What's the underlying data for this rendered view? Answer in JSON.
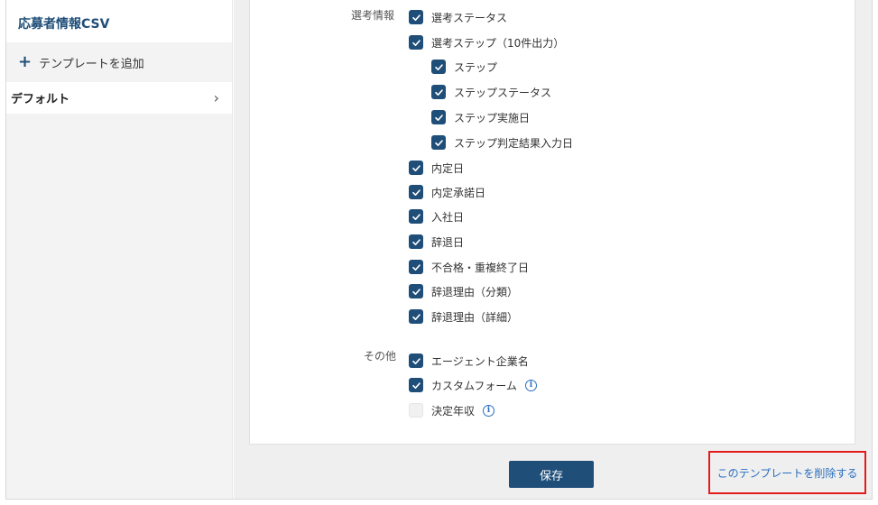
{
  "sidebar": {
    "title": "応募者情報CSV",
    "add_template": "テンプレートを追加",
    "items": [
      {
        "label": "デフォルト"
      }
    ]
  },
  "sections": [
    {
      "label": "選考情報",
      "items": [
        {
          "label": "選考ステータス",
          "checked": true,
          "indent": 0
        },
        {
          "label": "選考ステップ（10件出力）",
          "checked": true,
          "indent": 0
        },
        {
          "label": "ステップ",
          "checked": true,
          "indent": 1
        },
        {
          "label": "ステップステータス",
          "checked": true,
          "indent": 1
        },
        {
          "label": "ステップ実施日",
          "checked": true,
          "indent": 1
        },
        {
          "label": "ステップ判定結果入力日",
          "checked": true,
          "indent": 1
        },
        {
          "label": "内定日",
          "checked": true,
          "indent": 0
        },
        {
          "label": "内定承諾日",
          "checked": true,
          "indent": 0
        },
        {
          "label": "入社日",
          "checked": true,
          "indent": 0
        },
        {
          "label": "辞退日",
          "checked": true,
          "indent": 0
        },
        {
          "label": "不合格・重複終了日",
          "checked": true,
          "indent": 0
        },
        {
          "label": "辞退理由（分類）",
          "checked": true,
          "indent": 0
        },
        {
          "label": "辞退理由（詳細）",
          "checked": true,
          "indent": 0
        }
      ]
    },
    {
      "label": "その他",
      "items": [
        {
          "label": "エージェント企業名",
          "checked": true,
          "indent": 0
        },
        {
          "label": "カスタムフォーム",
          "checked": true,
          "indent": 0,
          "info": true
        },
        {
          "label": "決定年収",
          "checked": false,
          "indent": 0,
          "info": true
        }
      ]
    }
  ],
  "footer": {
    "save_label": "保存",
    "delete_label": "このテンプレートを削除する"
  },
  "icons": {
    "plus": "plus-icon",
    "chevron": "chevron-right-icon",
    "check": "check-icon",
    "info": "info-icon"
  },
  "colors": {
    "primary": "#1f4e79",
    "link": "#2a6fbf",
    "highlight": "#e31b1b"
  }
}
